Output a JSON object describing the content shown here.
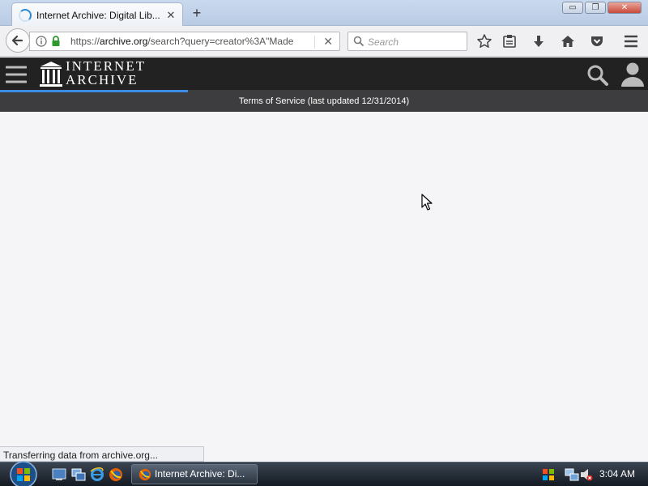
{
  "browser": {
    "tab_title": "Internet Archive: Digital Lib...",
    "tab_close": "✕",
    "new_tab": "+",
    "window_buttons": {
      "minimize": "▭",
      "restore": "❐",
      "close": "✕"
    },
    "url_scheme": "https://",
    "url_domain": "archive.org",
    "url_rest": "/search?query=creator%3A\"Made",
    "url_clear": "✕",
    "search_placeholder": "Search"
  },
  "site": {
    "logo_line1": "INTERNET",
    "logo_line2": "ARCHIVE",
    "tos_text": "Terms of Service (last updated 12/31/2014)",
    "load_progress": 0.29
  },
  "status": {
    "text": "Transferring data from archive.org..."
  },
  "taskbar": {
    "task_label": "Internet Archive: Di...",
    "clock": "3:04 AM"
  },
  "colors": {
    "accent": "#3d8ce6",
    "header_bg": "#222222",
    "tos_bg": "#3d3d3f",
    "page_bg": "#f5f5f7"
  }
}
